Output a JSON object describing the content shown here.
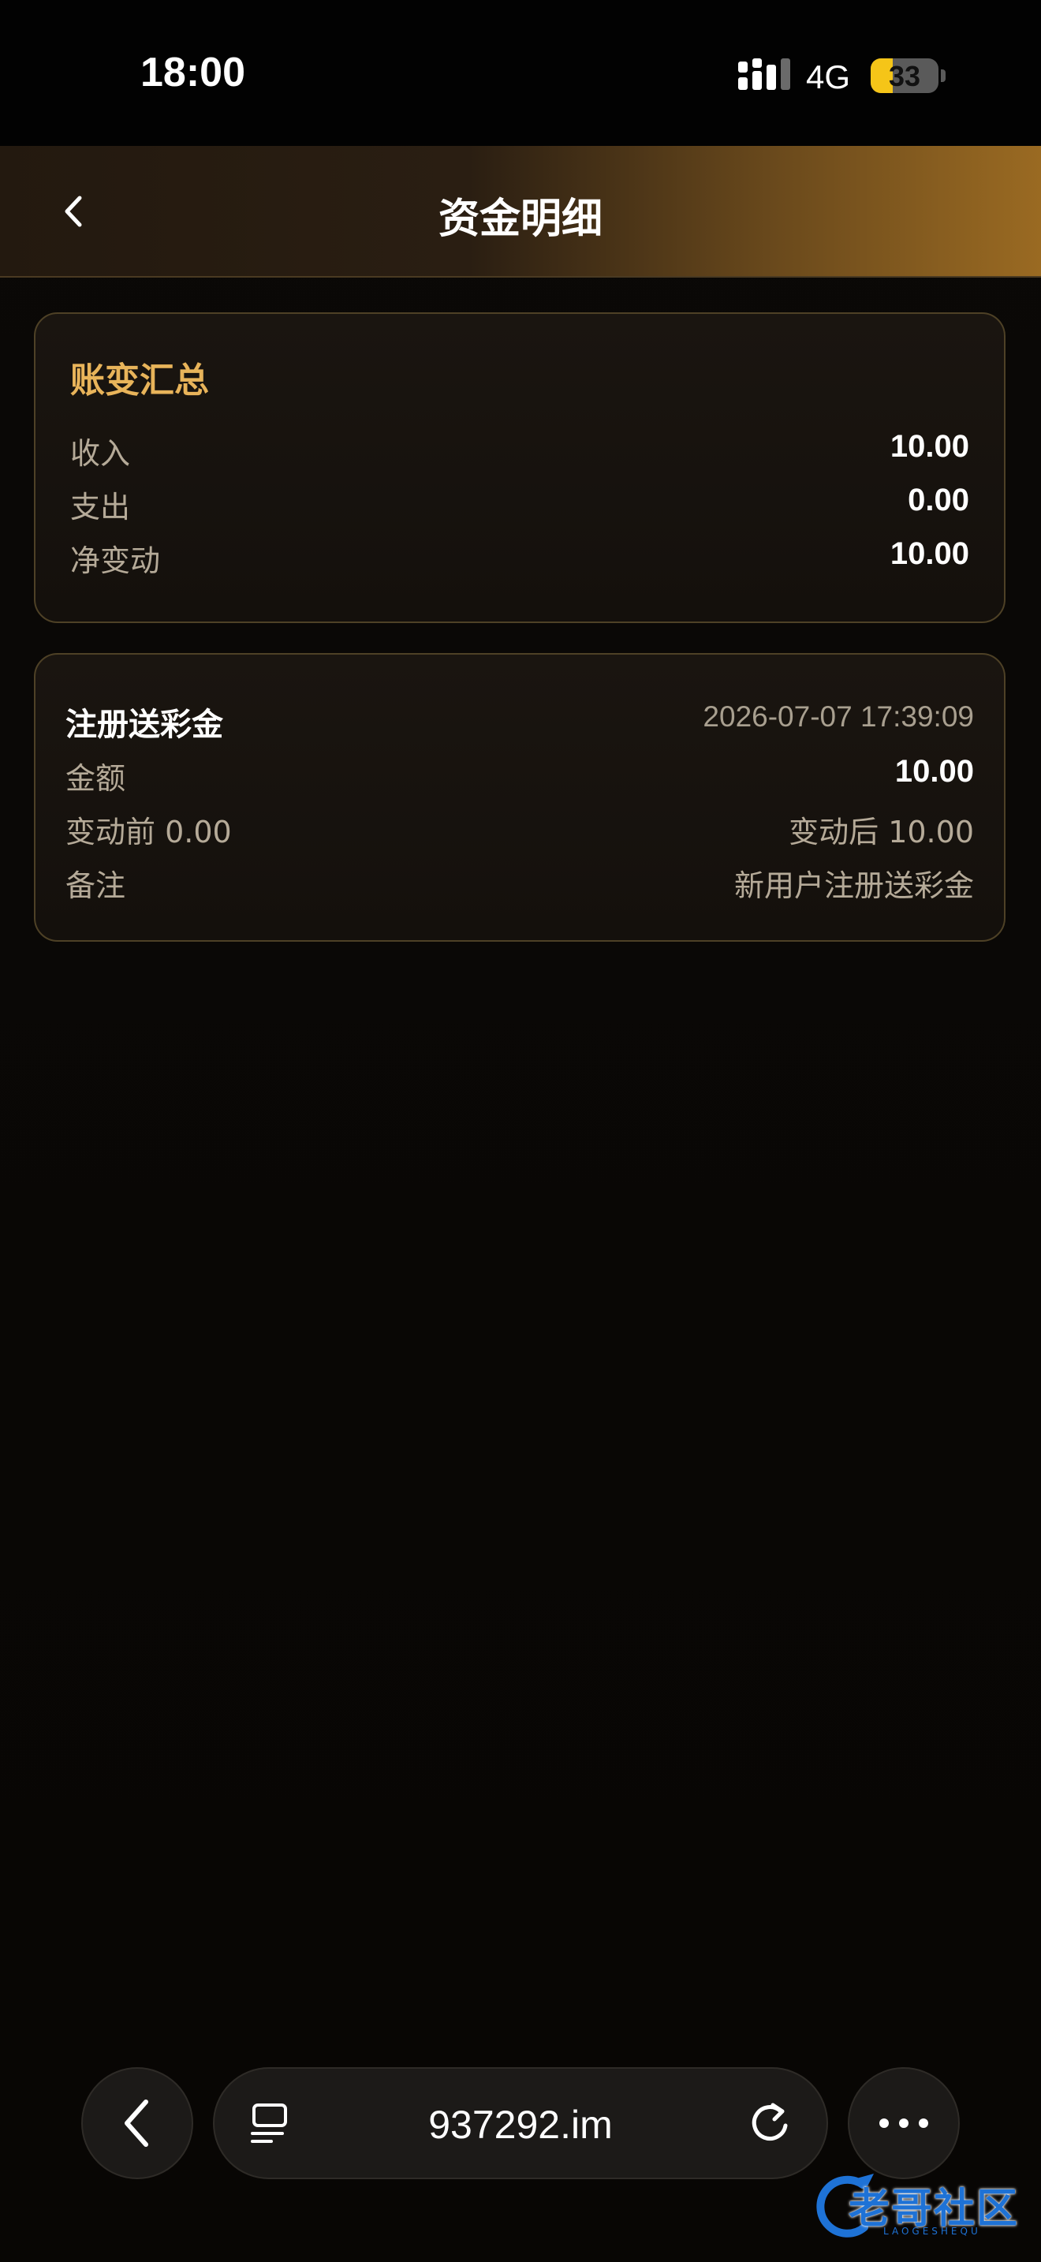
{
  "status_bar": {
    "time": "18:00",
    "network": "4G",
    "battery": "33",
    "battery_level_percent": 33
  },
  "header": {
    "title": "资金明细",
    "back_icon": "chevron-left-icon"
  },
  "summary": {
    "title": "账变汇总",
    "rows": [
      {
        "label": "收入",
        "value": "10.00"
      },
      {
        "label": "支出",
        "value": "0.00"
      },
      {
        "label": "净变动",
        "value": "10.00"
      }
    ]
  },
  "transaction": {
    "title": "注册送彩金",
    "time": "2026-07-07 17:39:09",
    "amount_label": "金额",
    "amount": "10.00",
    "before": "变动前 0.00",
    "after": "变动后 10.00",
    "note_label": "备注",
    "note": "新用户注册送彩金"
  },
  "browser": {
    "url": "937292.im",
    "icons": [
      "back-icon",
      "tabs-icon",
      "reload-icon",
      "more-icon"
    ]
  },
  "watermark": {
    "text": "老哥社区",
    "sub": "LAOGESHEQU"
  },
  "colors": {
    "accent_gold": "#e8b45a",
    "card_border": "#4e4126",
    "background": "#0a0806",
    "watermark_blue": "#1e72d6"
  }
}
